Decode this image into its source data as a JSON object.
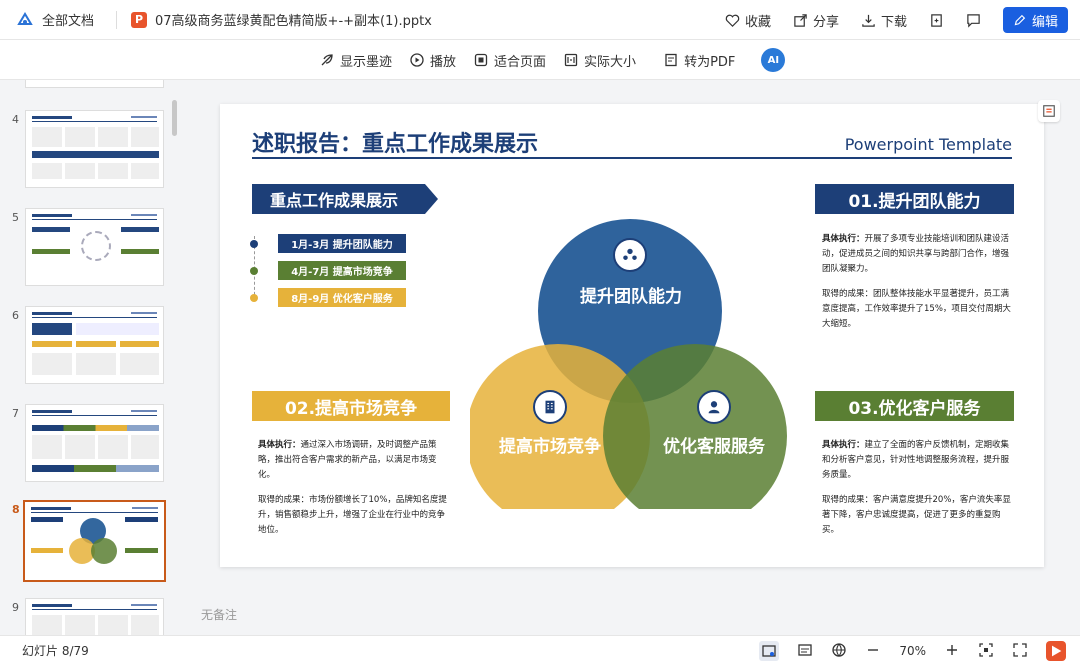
{
  "topbar": {
    "all_docs": "全部文档",
    "file_icon_letter": "P",
    "filename": "07高级商务蓝绿黄配色精简版+-+副本(1).pptx",
    "favorite": "收藏",
    "share": "分享",
    "download": "下载",
    "edit": "编辑"
  },
  "toolbar": {
    "ink": "显示墨迹",
    "play": "播放",
    "fit_page": "适合页面",
    "actual_size": "实际大小",
    "to_pdf": "转为PDF",
    "ai": "AI"
  },
  "thumbnails": [
    {
      "num": "4",
      "active": false
    },
    {
      "num": "5",
      "active": false
    },
    {
      "num": "6",
      "active": false
    },
    {
      "num": "7",
      "active": false
    },
    {
      "num": "8",
      "active": true
    },
    {
      "num": "9",
      "active": false
    }
  ],
  "slide": {
    "title": "述职报告：重点工作成果展示",
    "subtitle": "Powerpoint Template",
    "ribbon": "重点工作成果展示",
    "timeline": [
      {
        "label": "1月-3月 提升团队能力",
        "color": "#1d3f78"
      },
      {
        "label": "4月-7月 提高市场竞争",
        "color": "#5a7f33"
      },
      {
        "label": "8月-9月 优化客户服务",
        "color": "#e6b23a"
      }
    ],
    "circles": {
      "top": "提升团队能力",
      "left": "提高市场竞争",
      "right": "优化客服服务"
    },
    "box1": {
      "head": "01.提升团队能力",
      "p1_label": "具体执行：",
      "p1": "开展了多项专业技能培训和团队建设活动，促进成员之间的知识共享与跨部门合作，增强团队凝聚力。",
      "p2": "取得的成果：团队整体技能水平显著提升，员工满意度提高，工作效率提升了15%，项目交付周期大大缩短。"
    },
    "box2": {
      "head": "02.提高市场竞争",
      "p1_label": "具体执行：",
      "p1": "通过深入市场调研，及时调整产品策略，推出符合客户需求的新产品，以满足市场变化。",
      "p2": "取得的成果：市场份额增长了10%，品牌知名度提升，销售额稳步上升，增强了企业在行业中的竞争地位。"
    },
    "box3": {
      "head": "03.优化客户服务",
      "p1_label": "具体执行：",
      "p1": "建立了全面的客户反馈机制，定期收集和分析客户意见，针对性地调整服务流程，提升服务质量。",
      "p2": "取得的成果：客户满意度提升20%，客户流失率显著下降，客户忠诚度提高，促进了更多的重复购买。"
    },
    "notes": "无备注"
  },
  "status": {
    "slide_count": "幻灯片 8/79",
    "zoom": "70%"
  },
  "colors": {
    "navy": "#1d3f78",
    "green": "#5a7f33",
    "gold": "#e6b23a",
    "accent_blue": "#1a5fe0",
    "active_orange": "#c85a1a"
  }
}
